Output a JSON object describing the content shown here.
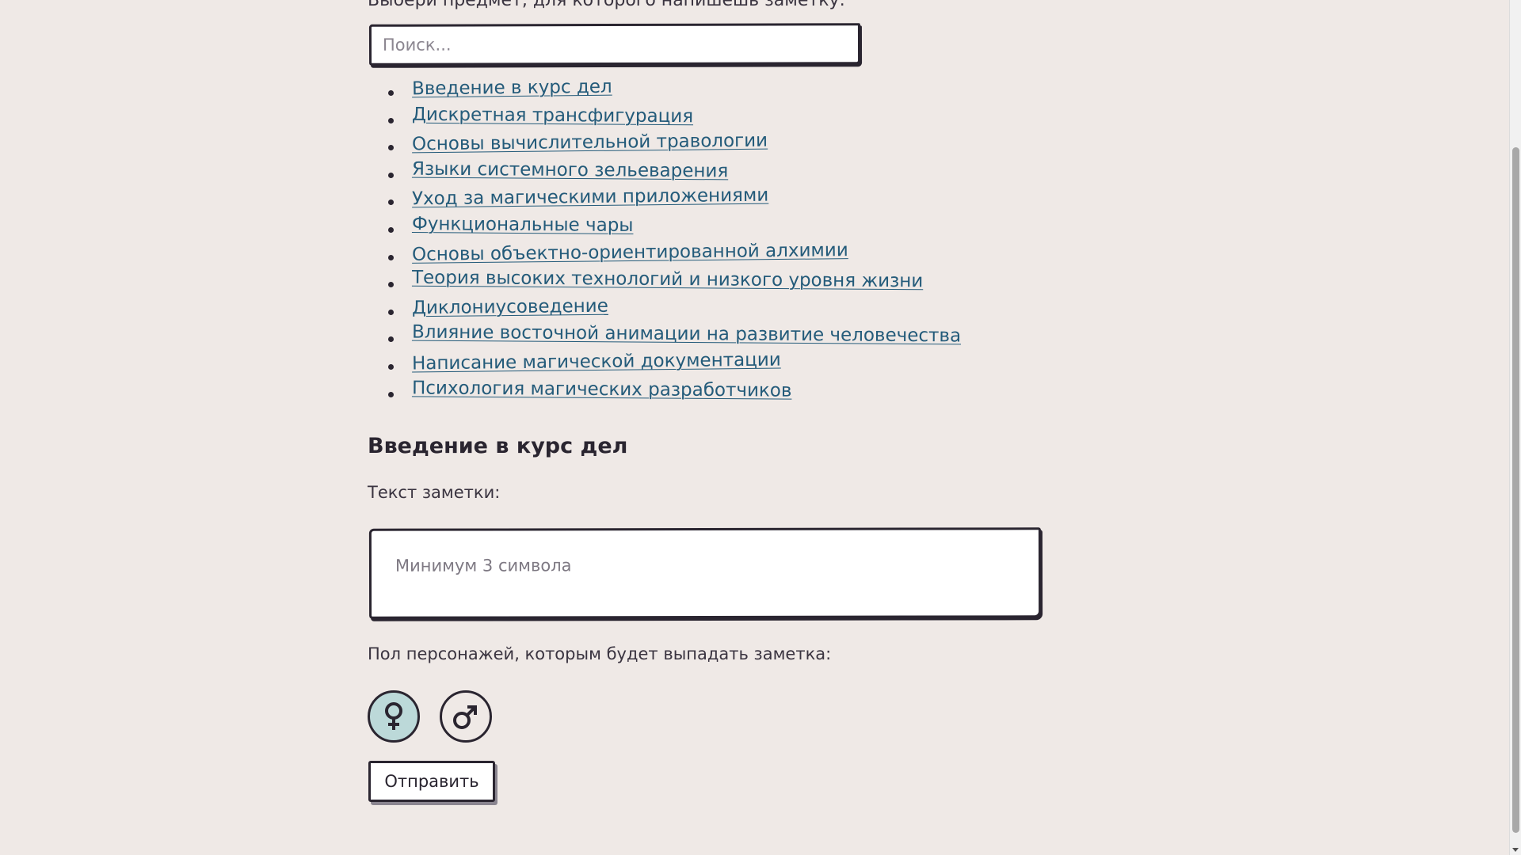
{
  "intro": "Выбери предмет, для которого напишешь заметку:",
  "search": {
    "placeholder": "Поиск..."
  },
  "subjects": [
    "Введение в курс дел",
    "Дискретная трансфигурация",
    "Основы вычислительной травологии",
    "Языки системного зельеварения",
    "Уход за магическими приложениями",
    "Функциональные чары",
    "Основы объектно-ориентированной алхимии",
    "Теория высоких технологий и низкого уровня жизни",
    "Диклониусоведение",
    "Влияние восточной анимации на развитие человечества",
    "Написание магической документации",
    "Психология магических разработчиков"
  ],
  "note": {
    "title": "Введение в курс дел",
    "label": "Текст заметки:",
    "placeholder": "Минимум 3 символа"
  },
  "gender": {
    "label": "Пол персонажей, которым будет выпадать заметка:",
    "options": [
      {
        "icon": "female-symbol-icon",
        "selected": true,
        "color": "#bcd9d9"
      },
      {
        "icon": "male-symbol-icon",
        "selected": false
      }
    ]
  },
  "submit_label": "Отправить"
}
